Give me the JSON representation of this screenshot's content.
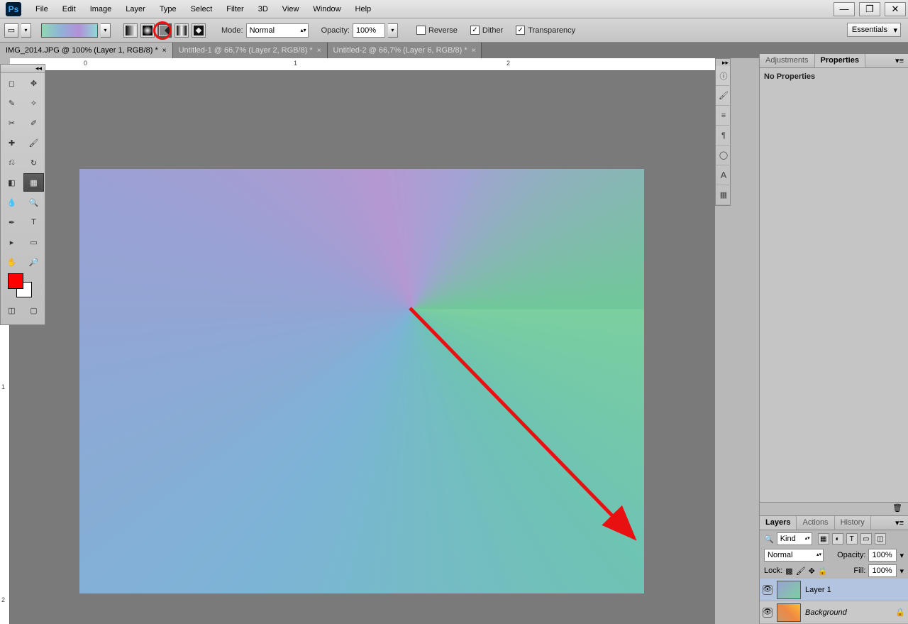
{
  "menubar": [
    "File",
    "Edit",
    "Image",
    "Layer",
    "Type",
    "Select",
    "Filter",
    "3D",
    "View",
    "Window",
    "Help"
  ],
  "options": {
    "mode_label": "Mode:",
    "mode_value": "Normal",
    "opacity_label": "Opacity:",
    "opacity_value": "100%",
    "reverse": "Reverse",
    "dither": "Dither",
    "transparency": "Transparency"
  },
  "workspace": "Essentials",
  "tabs": [
    {
      "label": "IMG_2014.JPG @ 100% (Layer 1, RGB/8) *",
      "active": true
    },
    {
      "label": "Untitled-1 @ 66,7% (Layer 2, RGB/8) *",
      "active": false
    },
    {
      "label": "Untitled-2 @ 66,7% (Layer 6, RGB/8) *",
      "active": false
    }
  ],
  "properties": {
    "tab1": "Adjustments",
    "tab2": "Properties",
    "empty": "No Properties"
  },
  "layers_panel": {
    "tabs": [
      "Layers",
      "Actions",
      "History"
    ],
    "filter_kind": "Kind",
    "blend_mode": "Normal",
    "opacity_label": "Opacity:",
    "opacity_value": "100%",
    "lock_label": "Lock:",
    "fill_label": "Fill:",
    "fill_value": "100%",
    "layers": [
      {
        "name": "Layer 1",
        "selected": true,
        "locked": false
      },
      {
        "name": "Background",
        "selected": false,
        "locked": true
      }
    ]
  },
  "ruler": {
    "h": [
      "0",
      "1",
      "2"
    ],
    "v": [
      "1",
      "2"
    ]
  }
}
